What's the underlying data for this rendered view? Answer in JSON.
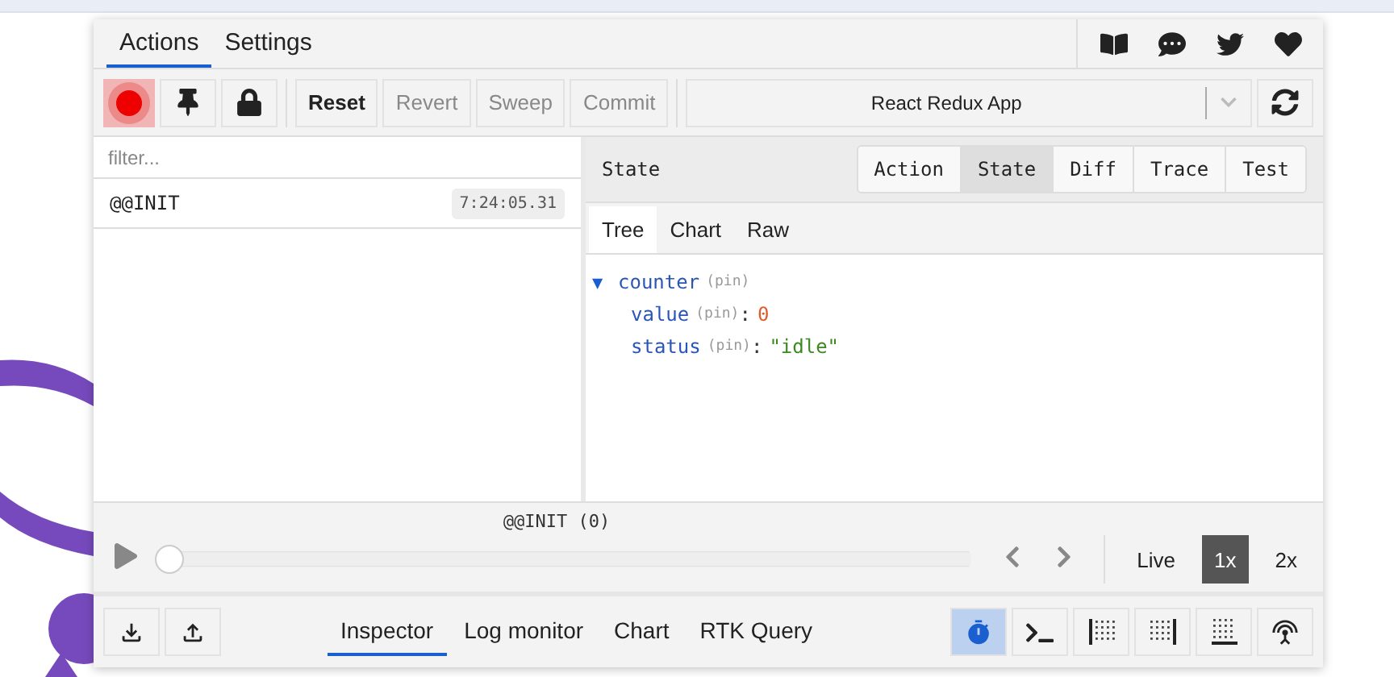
{
  "top_tabs": [
    {
      "label": "Actions",
      "selected": true
    },
    {
      "label": "Settings",
      "selected": false
    }
  ],
  "header_links": [
    {
      "kind": "book"
    },
    {
      "kind": "chat"
    },
    {
      "kind": "twitter"
    },
    {
      "kind": "heart"
    }
  ],
  "toolbar": {
    "record": {
      "active": true
    },
    "tools": [
      {
        "kind": "pin"
      },
      {
        "kind": "lock"
      }
    ],
    "actions": [
      {
        "label": "Reset",
        "disabled": false
      },
      {
        "label": "Revert",
        "disabled": true
      },
      {
        "label": "Sweep",
        "disabled": true
      },
      {
        "label": "Commit",
        "disabled": true
      }
    ],
    "instance": "React Redux App"
  },
  "filter": {
    "placeholder": "filter..."
  },
  "action_list": [
    {
      "name": "@@INIT",
      "time": "7:24:05.31",
      "selected": false
    }
  ],
  "inspector": {
    "title": "State",
    "tabs": [
      {
        "label": "Action",
        "selected": false
      },
      {
        "label": "State",
        "selected": true
      },
      {
        "label": "Diff",
        "selected": false
      },
      {
        "label": "Trace",
        "selected": false
      },
      {
        "label": "Test",
        "selected": false
      }
    ],
    "subtabs": [
      {
        "label": "Tree",
        "selected": true
      },
      {
        "label": "Chart",
        "selected": false
      },
      {
        "label": "Raw",
        "selected": false
      }
    ],
    "tree": [
      {
        "key": "counter",
        "toggle": "▼",
        "pin": "(pin)",
        "expanded": true,
        "children": [
          {
            "key": "value",
            "pin": "(pin)",
            "separator": ":",
            "value": "0",
            "kind": "number"
          },
          {
            "key": "status",
            "pin": "(pin)",
            "separator": ":",
            "value": "\"idle\"",
            "kind": "string"
          }
        ]
      }
    ]
  },
  "slider": {
    "label": "@@INIT (0)",
    "level": 0,
    "speeds": [
      {
        "label": "Live",
        "selected": false
      },
      {
        "label": "1x",
        "selected": true
      },
      {
        "label": "2x",
        "selected": false
      }
    ]
  },
  "bottom": {
    "tabs": [
      {
        "label": "Inspector",
        "selected": true
      },
      {
        "label": "Log monitor",
        "selected": false
      },
      {
        "label": "Chart",
        "selected": false
      },
      {
        "label": "RTK Query",
        "selected": false
      }
    ],
    "tools": [
      {
        "kind": "timer",
        "active": true
      },
      {
        "kind": "terminal",
        "active": false
      },
      {
        "kind": "dock-left",
        "active": false
      },
      {
        "kind": "dock-right",
        "active": false
      },
      {
        "kind": "dock-bottom",
        "active": false
      },
      {
        "kind": "remote",
        "active": false
      }
    ]
  }
}
